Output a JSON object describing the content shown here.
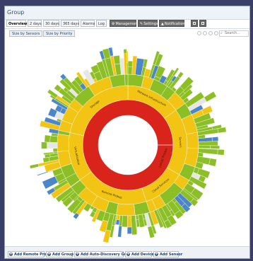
{
  "window": {
    "title": "Group"
  },
  "tabs": [
    {
      "label": "Overview",
      "active": true
    },
    {
      "label": "2 days"
    },
    {
      "label": "30 days"
    },
    {
      "label": "365 days"
    },
    {
      "label": "Alarms"
    },
    {
      "label": "Log"
    }
  ],
  "toolbar": {
    "management_label": "Management",
    "settings_label": "Settings",
    "notifications_label": "Notifications",
    "management_icon": "cog-icon",
    "settings_icon": "wrench-icon",
    "notifications_icon": "warning-icon"
  },
  "view": {
    "size_by_sensors": "Size by Sensors",
    "size_by_priority": "Size by Priority",
    "search_placeholder": "Search..."
  },
  "chart": {
    "type": "sunburst",
    "colors": {
      "down": "#d9241c",
      "warning": "#f2c515",
      "up": "#8cbf26",
      "paused": "#4a86c8",
      "unknown": "#e6e6e6"
    },
    "rings": {
      "level1": [
        {
          "name": "Local Probe",
          "status": "down"
        }
      ],
      "level2": [
        {
          "name": "Network Infrastructure",
          "status": "warning"
        },
        {
          "name": "Servers",
          "status": "warning"
        },
        {
          "name": "Cloud Services",
          "status": "warning"
        },
        {
          "name": "Remote Probes",
          "status": "warning"
        },
        {
          "name": "Virtualization",
          "status": "warning"
        },
        {
          "name": "Storage",
          "status": "warning"
        }
      ]
    }
  },
  "footer": {
    "add_remote_probe": "Add Remote Probe",
    "add_group": "Add Group",
    "add_auto_discovery_group": "Add Auto-Discovery Group",
    "add_device": "Add Device",
    "add_sensor": "Add Sensor"
  }
}
